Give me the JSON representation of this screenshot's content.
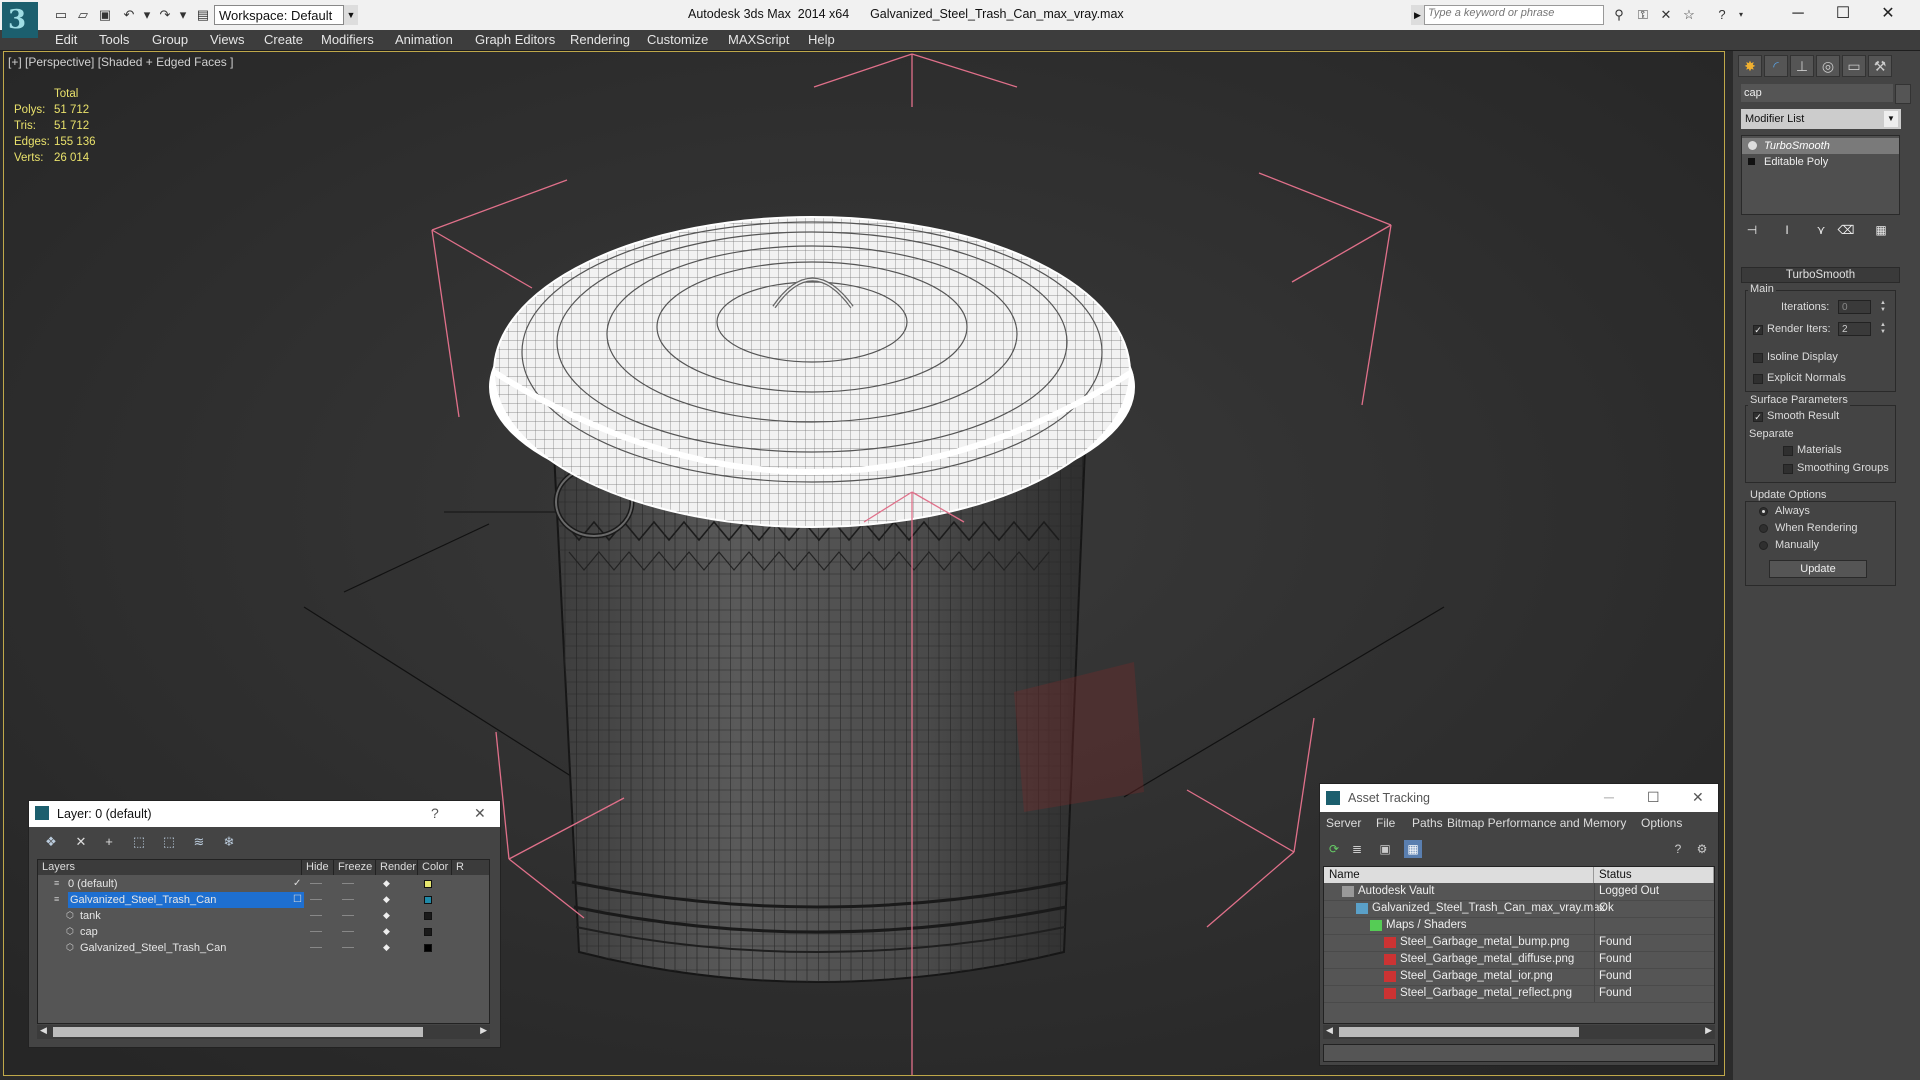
{
  "app": {
    "title": "Autodesk 3ds Max  2014 x64",
    "file": "Galvanized_Steel_Trash_Can_max_vray.max",
    "workspace": "Workspace: Default",
    "search_placeholder": "Type a keyword or phrase",
    "logo_glyph": "3"
  },
  "menu": [
    "Edit",
    "Tools",
    "Group",
    "Views",
    "Create",
    "Modifiers",
    "Animation",
    "Graph Editors",
    "Rendering",
    "Customize",
    "MAXScript",
    "Help"
  ],
  "viewport": {
    "label": "[+] [Perspective] [Shaded + Edged Faces ]",
    "stats_header": "Total",
    "stats": [
      {
        "label": "Polys:",
        "value": "51 712"
      },
      {
        "label": "Tris:",
        "value": "51 712"
      },
      {
        "label": "Edges:",
        "value": "155 136"
      },
      {
        "label": "Verts:",
        "value": "26 014"
      }
    ]
  },
  "command_panel": {
    "object_name": "cap",
    "modifier_list": "Modifier List",
    "stack": [
      "TurboSmooth",
      "Editable Poly"
    ],
    "rollout_title": "TurboSmooth",
    "main_group": "Main",
    "iterations_label": "Iterations:",
    "iterations_value": "0",
    "render_iters_label": "Render Iters:",
    "render_iters_value": "2",
    "render_iters_checked": true,
    "isoline_label": "Isoline Display",
    "explicit_normals_label": "Explicit Normals",
    "surface_group": "Surface Parameters",
    "smooth_result_label": "Smooth Result",
    "separate_label": "Separate",
    "materials_label": "Materials",
    "smoothing_groups_label": "Smoothing Groups",
    "update_group": "Update Options",
    "always_label": "Always",
    "when_rendering_label": "When Rendering",
    "manually_label": "Manually",
    "update_button": "Update"
  },
  "layer_dialog": {
    "title": "Layer: 0 (default)",
    "help": "?",
    "columns": [
      "Layers",
      "Hide",
      "Freeze",
      "Render",
      "Color",
      "R"
    ],
    "rows": [
      {
        "name": "0 (default)",
        "level": 0,
        "selected": false,
        "color": "#e6e66e",
        "active": true
      },
      {
        "name": "Galvanized_Steel_Trash_Can",
        "level": 0,
        "selected": true,
        "color": "#1f8aa8",
        "active": false
      },
      {
        "name": "tank",
        "level": 1,
        "selected": false,
        "color": "#1a1a1a",
        "active": false
      },
      {
        "name": "cap",
        "level": 1,
        "selected": false,
        "color": "#1a1a1a",
        "active": false
      },
      {
        "name": "Galvanized_Steel_Trash_Can",
        "level": 1,
        "selected": false,
        "color": "#000000",
        "active": false
      }
    ]
  },
  "asset_tracking": {
    "title": "Asset Tracking",
    "menu": [
      "Server",
      "File",
      "Paths",
      "Bitmap Performance and Memory",
      "Options"
    ],
    "columns": [
      "Name",
      "Status"
    ],
    "rows": [
      {
        "name": "Autodesk Vault",
        "status": "Logged Out",
        "level": 0,
        "icon": "vault-icon"
      },
      {
        "name": "Galvanized_Steel_Trash_Can_max_vray.max",
        "status": "Ok",
        "level": 1,
        "icon": "max-file-icon"
      },
      {
        "name": "Maps / Shaders",
        "status": "",
        "level": 2,
        "icon": "maps-icon"
      },
      {
        "name": "Steel_Garbage_metal_bump.png",
        "status": "Found",
        "level": 3,
        "icon": "png-icon"
      },
      {
        "name": "Steel_Garbage_metal_diffuse.png",
        "status": "Found",
        "level": 3,
        "icon": "png-icon"
      },
      {
        "name": "Steel_Garbage_metal_ior.png",
        "status": "Found",
        "level": 3,
        "icon": "png-icon"
      },
      {
        "name": "Steel_Garbage_metal_reflect.png",
        "status": "Found",
        "level": 3,
        "icon": "png-icon"
      }
    ]
  },
  "colors": {
    "selection_bracket": "#e0708a",
    "stats_text": "#e9e16b",
    "selected_row": "#1e6fd0",
    "viewport_border": "#bfa84a"
  }
}
